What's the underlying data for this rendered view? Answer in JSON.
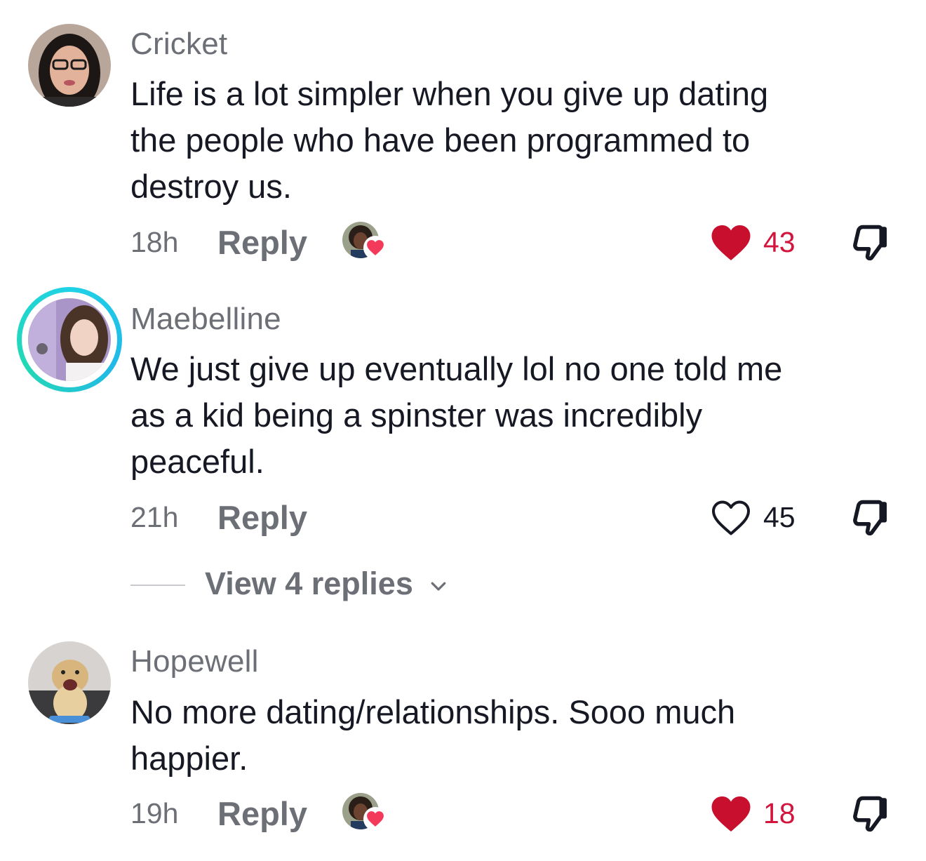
{
  "comments": [
    {
      "username": "Cricket",
      "text": "Life is a lot simpler when you give up dating\nthe people who have been programmed to\ndestroy us.",
      "time": "18h",
      "reply_label": "Reply",
      "liked": true,
      "like_count": "43",
      "creator_liked": true
    },
    {
      "username": "Maebelline",
      "text": "We just give up eventually lol no one told me\nas a kid being a spinster was incredibly\npeaceful.",
      "time": "21h",
      "reply_label": "Reply",
      "liked": false,
      "like_count": "45",
      "creator_liked": false,
      "view_replies": "View 4 replies"
    },
    {
      "username": "Hopewell",
      "text": "No more dating/relationships. Sooo much\nhappier.",
      "time": "19h",
      "reply_label": "Reply",
      "liked": true,
      "like_count": "18",
      "creator_liked": true
    }
  ],
  "colors": {
    "liked_red": "#d3143c",
    "secondary_gray": "#6d6f76",
    "story_ring": "#1fd2e6"
  },
  "icons": {
    "like": "heart-icon",
    "dislike": "thumbs-down-icon",
    "expand": "chevron-down-icon"
  }
}
